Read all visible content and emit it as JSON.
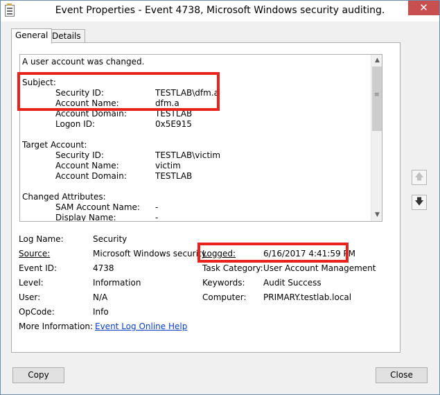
{
  "window": {
    "title": "Event Properties - Event 4738, Microsoft Windows security auditing.",
    "close_glyph": "✕"
  },
  "tabs": {
    "general": "General",
    "details": "Details"
  },
  "description": {
    "summary": "A user account was changed.",
    "subject_header": "Subject:",
    "subject": [
      {
        "label": "Security ID:",
        "value": "TESTLAB\\dfm.a"
      },
      {
        "label": "Account Name:",
        "value": "dfm.a"
      },
      {
        "label": "Account Domain:",
        "value": "TESTLAB"
      },
      {
        "label": "Logon ID:",
        "value": "0x5E915"
      }
    ],
    "target_header": "Target Account:",
    "target": [
      {
        "label": "Security ID:",
        "value": "TESTLAB\\victim"
      },
      {
        "label": "Account Name:",
        "value": "victim"
      },
      {
        "label": "Account Domain:",
        "value": "TESTLAB"
      }
    ],
    "changed_header": "Changed Attributes:",
    "changed": [
      {
        "label": "SAM Account Name:",
        "value": "-"
      },
      {
        "label": "Display Name:",
        "value": "-"
      }
    ]
  },
  "properties": {
    "log_name": {
      "label": "Log Name:",
      "value": "Security"
    },
    "source": {
      "label": "Source:",
      "value": "Microsoft Windows security"
    },
    "logged": {
      "label": "Logged:",
      "value": "6/16/2017 4:41:59 PM"
    },
    "event_id": {
      "label": "Event ID:",
      "value": "4738"
    },
    "task_category": {
      "label": "Task Category:",
      "value": "User Account Management"
    },
    "level": {
      "label": "Level:",
      "value": "Information"
    },
    "keywords": {
      "label": "Keywords:",
      "value": "Audit Success"
    },
    "user": {
      "label": "User:",
      "value": "N/A"
    },
    "computer": {
      "label": "Computer:",
      "value": "PRIMARY.testlab.local"
    },
    "opcode": {
      "label": "OpCode:",
      "value": "Info"
    },
    "more_info": {
      "label": "More Information:",
      "value": "Event Log Online Help"
    }
  },
  "buttons": {
    "copy": "Copy",
    "close": "Close",
    "previous_glyph": "🡅",
    "next_glyph": "🡇"
  },
  "scrollbar": {
    "up_glyph": "▲",
    "down_glyph": "▼",
    "grip_glyph": "≡"
  },
  "colors": {
    "highlight": "#e8221d",
    "link": "#0b3fc6",
    "close_button": "#c74f4f"
  }
}
